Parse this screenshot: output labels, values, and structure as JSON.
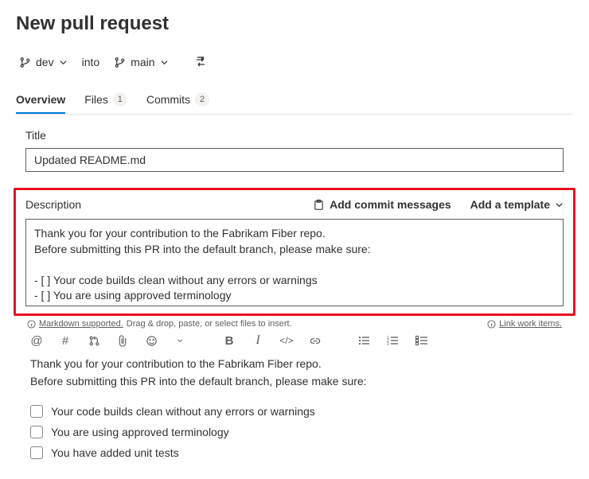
{
  "page": {
    "title": "New pull request"
  },
  "branch_row": {
    "source_branch": "dev",
    "into_label": "into",
    "target_branch": "main"
  },
  "tabs": {
    "overview": {
      "label": "Overview"
    },
    "files": {
      "label": "Files",
      "count": "1"
    },
    "commits": {
      "label": "Commits",
      "count": "2"
    }
  },
  "form": {
    "title_label": "Title",
    "title_value": "Updated README.md",
    "description_label": "Description",
    "add_commit_messages": "Add commit messages",
    "add_template": "Add a template",
    "description_value": "Thank you for your contribution to the Fabrikam Fiber repo.\nBefore submitting this PR into the default branch, please make sure:\n\n- [ ] Your code builds clean without any errors or warnings\n- [ ] You are using approved terminology\n- [ ] You have added unit tests"
  },
  "hints": {
    "markdown_supported": "Markdown supported.",
    "drag_drop": "Drag & drop, paste, or select files to insert.",
    "link_work_items": "Link work items."
  },
  "preview": {
    "line1": "Thank you for your contribution to the Fabrikam Fiber repo.",
    "line2": "Before submitting this PR into the default branch, please make sure:",
    "checks": [
      "Your code builds clean without any errors or warnings",
      "You are using approved terminology",
      "You have added unit tests"
    ]
  }
}
